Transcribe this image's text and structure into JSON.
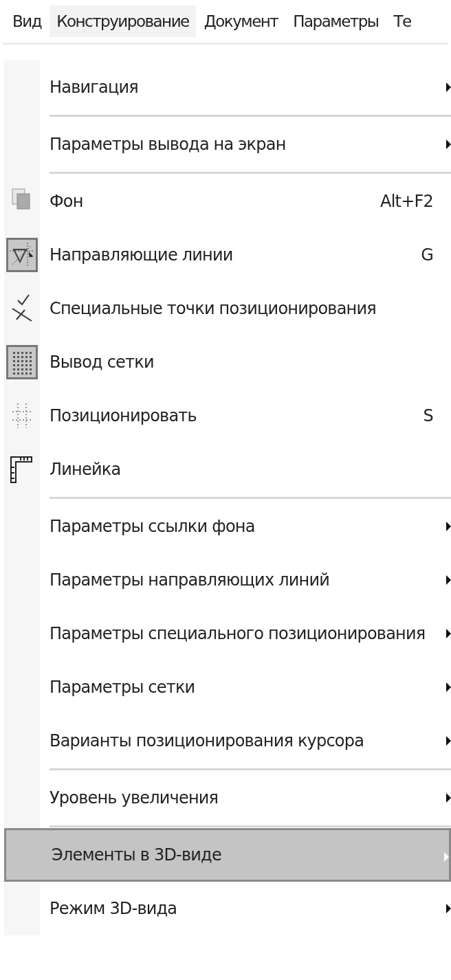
{
  "menubar": [
    {
      "label": "Вид",
      "selected": false
    },
    {
      "label": "Конструирование",
      "selected": true
    },
    {
      "label": "Документ",
      "selected": false
    },
    {
      "label": "Параметры",
      "selected": false
    },
    {
      "label": "Те",
      "selected": false
    }
  ],
  "menu": [
    {
      "kind": "submenu",
      "label": "Навигация",
      "selected": false
    },
    {
      "kind": "separator"
    },
    {
      "kind": "submenu",
      "label": "Параметры вывода на экран",
      "selected": false
    },
    {
      "kind": "separator"
    },
    {
      "kind": "command",
      "label": "Фон",
      "shortcut": "Alt+F2",
      "checked": false,
      "selected": false
    },
    {
      "kind": "command",
      "label": "Направляющие линии",
      "shortcut": "G",
      "checked": true,
      "selected": false
    },
    {
      "kind": "command",
      "label": "Специальные точки позиционирования",
      "checked": false,
      "selected": false
    },
    {
      "kind": "command",
      "label": "Вывод сетки",
      "checked": true,
      "selected": false
    },
    {
      "kind": "command",
      "label": "Позиционировать",
      "shortcut": "S",
      "checked": false,
      "selected": false
    },
    {
      "kind": "command",
      "label": "Линейка",
      "checked": false,
      "selected": false
    },
    {
      "kind": "separator"
    },
    {
      "kind": "submenu",
      "label": "Параметры ссылки фона",
      "selected": false
    },
    {
      "kind": "submenu",
      "label": "Параметры направляющих линий",
      "selected": false
    },
    {
      "kind": "submenu",
      "label": "Параметры специального позиционирования",
      "selected": false
    },
    {
      "kind": "submenu",
      "label": "Параметры сетки",
      "selected": false
    },
    {
      "kind": "submenu",
      "label": "Варианты позиционирования курсора",
      "selected": false
    },
    {
      "kind": "separator"
    },
    {
      "kind": "submenu",
      "label": "Уровень увеличения",
      "selected": false
    },
    {
      "kind": "separator"
    },
    {
      "kind": "submenu",
      "label": "Элементы в 3D-виде",
      "selected": true
    },
    {
      "kind": "submenu",
      "label": "Режим 3D-вида",
      "selected": false
    }
  ]
}
